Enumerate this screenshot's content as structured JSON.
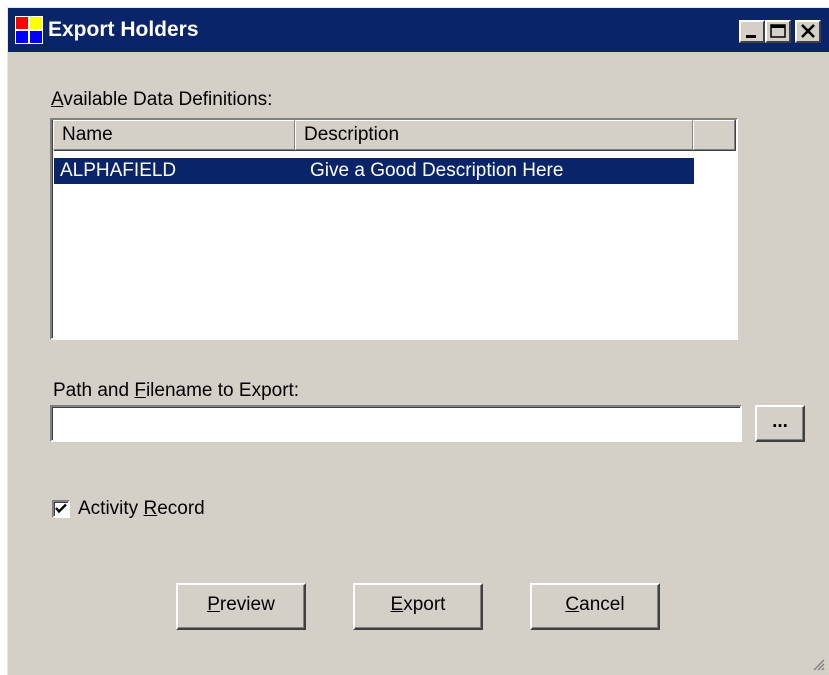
{
  "window": {
    "title": "Export Holders",
    "colors": {
      "titlebar": "#0a246a",
      "face": "#d4d0c8",
      "selection": "#0a246a"
    },
    "caption_buttons": [
      "minimize-icon",
      "maximize-icon",
      "close-icon"
    ]
  },
  "data_definitions": {
    "label_access_key": "A",
    "label_rest": "vailable Data Definitions:",
    "columns": [
      "Name",
      "Description"
    ],
    "rows": [
      {
        "name": "ALPHAFIELD",
        "description": "Give a Good Description Here",
        "selected": true
      }
    ]
  },
  "export_path": {
    "label_prefix": "Path and ",
    "label_access_key": "F",
    "label_suffix": "ilename to Export:",
    "value": "",
    "browse_label": "..."
  },
  "activity_record": {
    "label_prefix": "Activity ",
    "label_access_key": "R",
    "label_suffix": "ecord",
    "checked": true
  },
  "buttons": {
    "preview": {
      "access_key": "P",
      "rest": "review"
    },
    "export": {
      "access_key": "E",
      "rest": "xport"
    },
    "cancel": {
      "access_key": "C",
      "rest": "ancel"
    }
  }
}
